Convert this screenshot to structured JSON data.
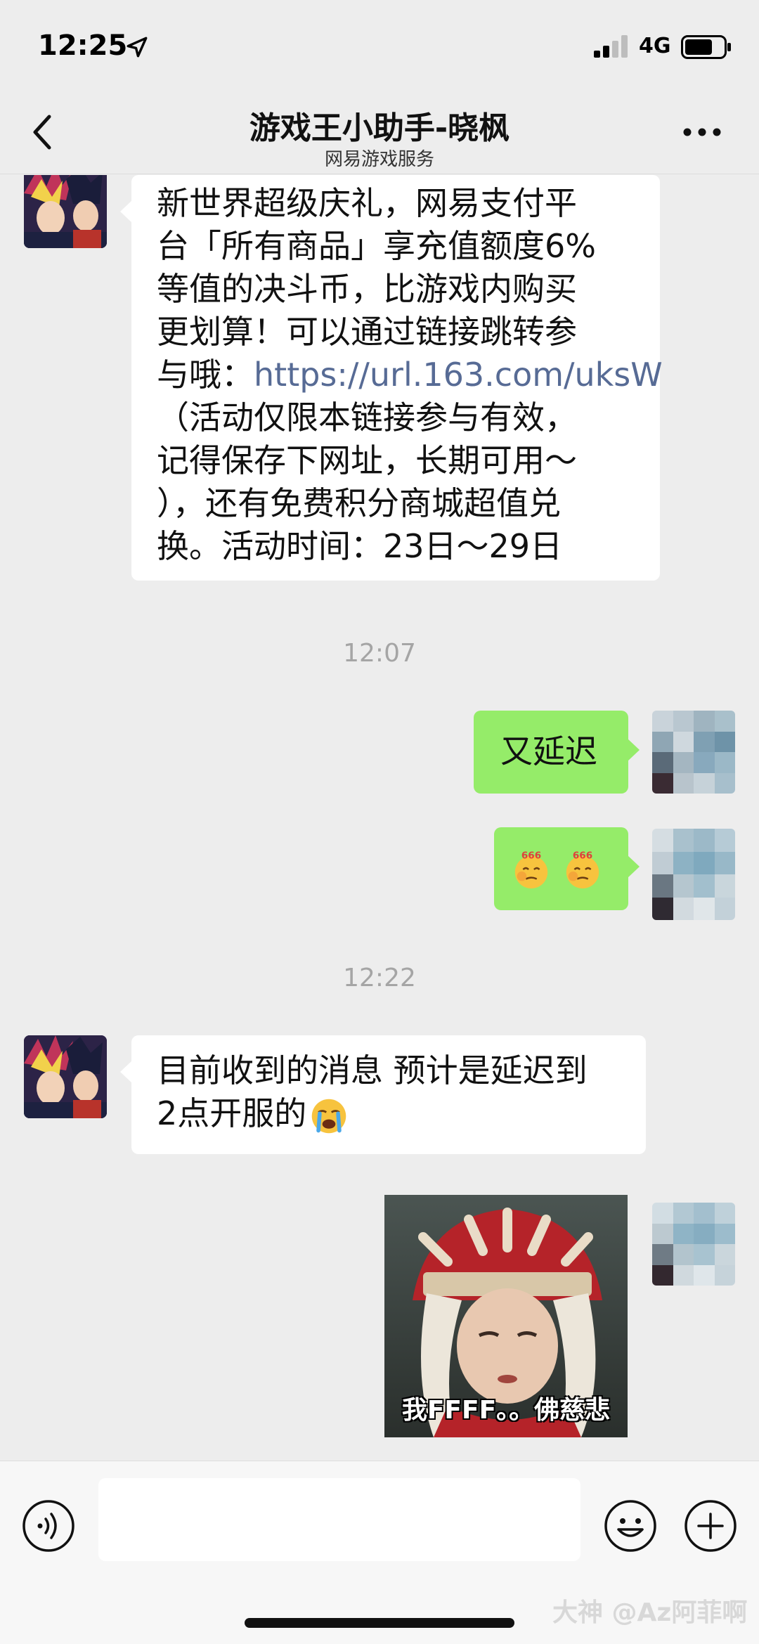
{
  "status": {
    "time": "12:25",
    "network": "4G"
  },
  "header": {
    "title": "游戏王小助手-晓枫",
    "subtitle": "网易游戏服务"
  },
  "messages": {
    "promo_lines": [
      "新世界超级庆礼，网易支付平",
      "台「所有商品」享充值额度6%",
      "等值的决斗币，比游戏内购买",
      "更划算！可以通过链接跳转参",
      "与哦："
    ],
    "promo_link": "https://url.163.com/uksW",
    "promo_lines_after": [
      "（活动仅限本链接参与有效，",
      "记得保存下网址，长期可用～",
      "），还有免费积分商城超值兑",
      "换。活动时间：23日～29日"
    ],
    "time1": "12:07",
    "reply1": "又延迟",
    "reply2_emoji": "666 666",
    "time2": "12:22",
    "notice_lines": [
      "目前收到的消息 预计是延迟到",
      "2点开服的"
    ],
    "sticker_caption": "我FFFF。。佛慈悲"
  },
  "input": {
    "value": "",
    "watermark": "大神 @Az阿菲啊"
  },
  "colors": {
    "background": "#ededed",
    "bubble_self": "#95ec69",
    "bubble_other": "#ffffff",
    "link": "#576b95",
    "timestamp": "#a5a5a5"
  },
  "icons": [
    "location-arrow-icon",
    "signal-icon",
    "battery-icon",
    "back-chevron-icon",
    "more-dots-icon",
    "voice-icon",
    "emoji-icon",
    "plus-icon"
  ]
}
